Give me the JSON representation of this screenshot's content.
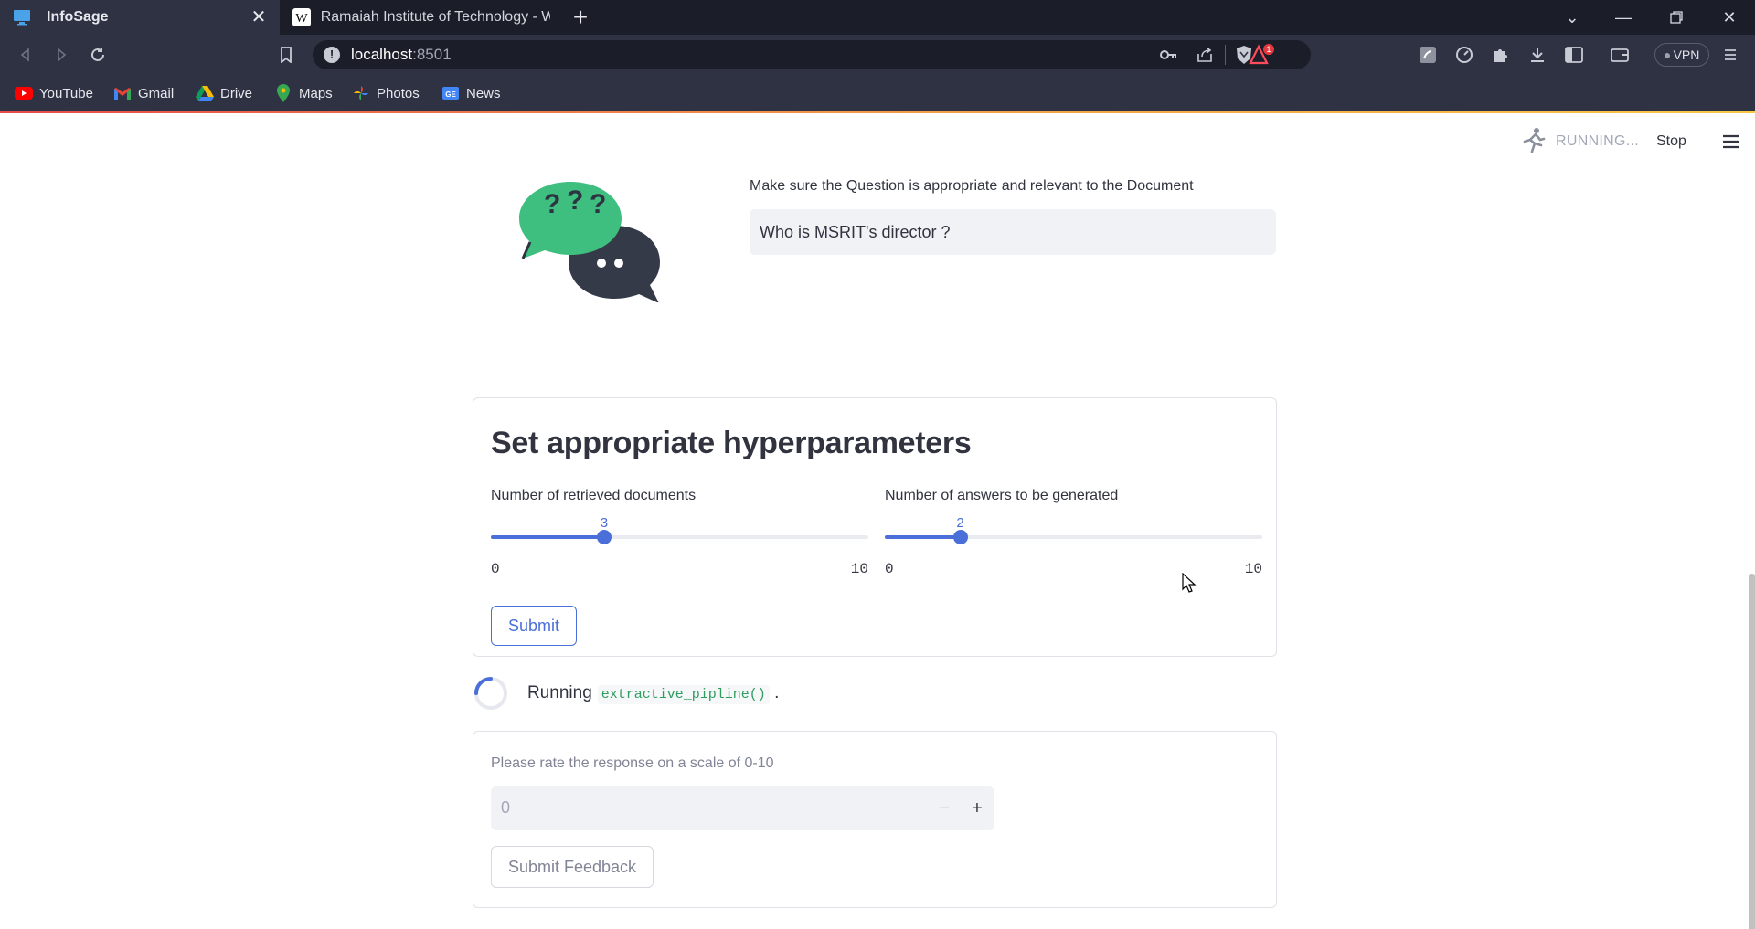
{
  "browser": {
    "tabs": [
      {
        "title": "InfoSage",
        "active": true
      },
      {
        "title": "Ramaiah Institute of Technology - Wik",
        "active": false
      }
    ],
    "url": {
      "host": "localhost",
      "port": ":8501"
    },
    "vpn_label": "VPN",
    "alert_count": "1",
    "bookmarks": [
      {
        "label": "YouTube",
        "icon": "youtube-icon"
      },
      {
        "label": "Gmail",
        "icon": "gmail-icon"
      },
      {
        "label": "Drive",
        "icon": "drive-icon"
      },
      {
        "label": "Maps",
        "icon": "maps-icon"
      },
      {
        "label": "Photos",
        "icon": "photos-icon"
      },
      {
        "label": "News",
        "icon": "news-icon"
      }
    ]
  },
  "app": {
    "status": {
      "running": "RUNNING...",
      "stop": "Stop"
    },
    "question": {
      "label": "Make sure the Question is appropriate and relevant to the Document",
      "value": "Who is MSRIT's director ?"
    },
    "hyperparams": {
      "title": "Set appropriate hyperparameters",
      "retrieved": {
        "label": "Number of retrieved documents",
        "value": 3,
        "min": 0,
        "max": 10
      },
      "answers": {
        "label": "Number of answers to be generated",
        "value": 2,
        "min": 0,
        "max": 10
      },
      "submit_label": "Submit"
    },
    "running": {
      "prefix": "Running",
      "code": "extractive_pipline()",
      "suffix": "."
    },
    "feedback": {
      "label": "Please rate the response on a scale of 0-10",
      "value": "0",
      "minus": "−",
      "plus": "+",
      "submit_label": "Submit Feedback"
    }
  },
  "colors": {
    "primary": "#4b6fd8",
    "chrome_dark": "#1b1e29",
    "chrome": "#2f3243",
    "code_green": "#2e9c5c"
  }
}
